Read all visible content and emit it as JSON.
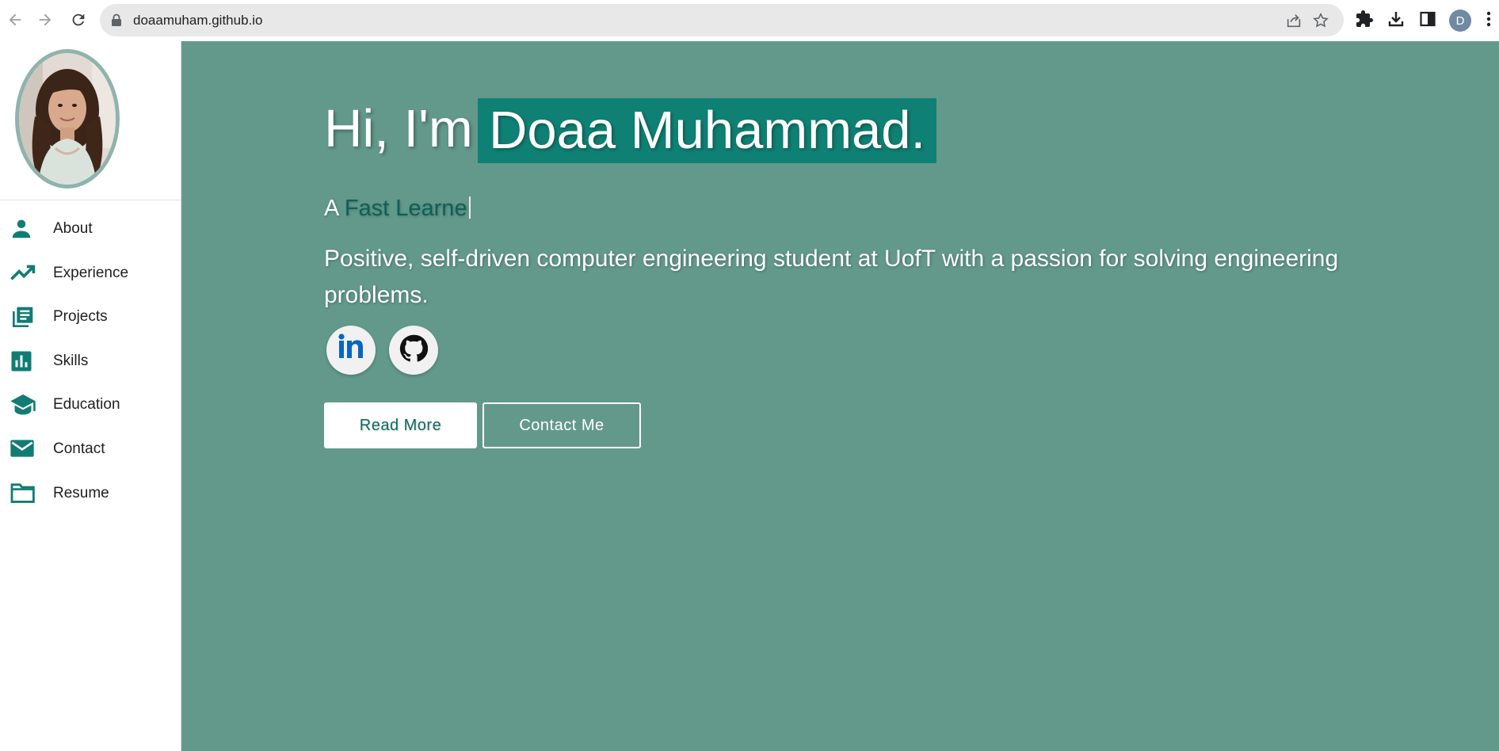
{
  "browser": {
    "url": "doaamuham.github.io",
    "profile_initial": "D"
  },
  "sidebar": {
    "items": [
      {
        "label": "About",
        "icon": "person-icon"
      },
      {
        "label": "Experience",
        "icon": "trending-up-icon"
      },
      {
        "label": "Projects",
        "icon": "library-books-icon"
      },
      {
        "label": "Skills",
        "icon": "bar-chart-icon"
      },
      {
        "label": "Education",
        "icon": "school-icon"
      },
      {
        "label": "Contact",
        "icon": "mail-icon"
      },
      {
        "label": "Resume",
        "icon": "folder-icon"
      }
    ]
  },
  "hero": {
    "greeting": "Hi, I'm",
    "name": "Doaa Muhammad.",
    "tagline_prefix": "A",
    "tagline_typed": "Fast Learne",
    "summary": "Positive, self-driven computer engineering student at UofT with a passion for solving engineering problems.",
    "read_more_label": "Read More",
    "contact_label": "Contact Me"
  },
  "colors": {
    "hero_bg": "#63998b",
    "accent": "#0f8174",
    "icon": "#127c74"
  }
}
